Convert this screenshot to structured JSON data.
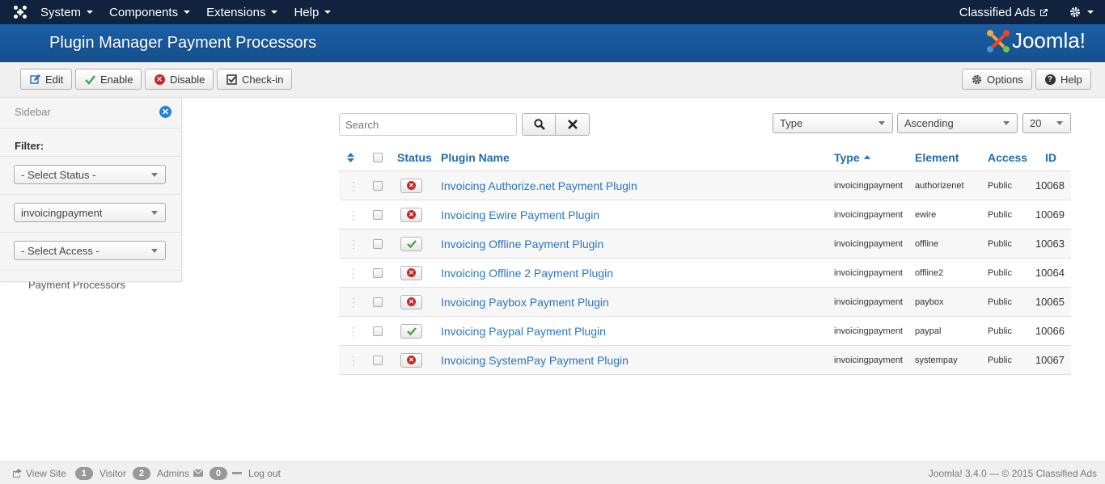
{
  "navbar": {
    "menu": [
      "System",
      "Components",
      "Extensions",
      "Help"
    ],
    "site_link": "Classified Ads"
  },
  "header": {
    "title": "Plugin Manager Payment Processors",
    "brand": "Joomla!"
  },
  "toolbar": {
    "edit": "Edit",
    "enable": "Enable",
    "disable": "Disable",
    "checkin": "Check-in",
    "options": "Options",
    "help": "Help"
  },
  "sidebar": {
    "heading": "Sidebar",
    "filter_label": "Filter:",
    "status_select": "- Select Status -",
    "type_select": "invoicingpayment",
    "access_select": "- Select Access -",
    "hidden_link": "Payment Processors"
  },
  "search": {
    "placeholder": "Search"
  },
  "list_controls": {
    "ordering": "Type",
    "direction": "Ascending",
    "limit": "20"
  },
  "table": {
    "headers": {
      "status": "Status",
      "name": "Plugin Name",
      "type": "Type",
      "element": "Element",
      "access": "Access",
      "id": "ID"
    },
    "rows": [
      {
        "name": "Invoicing Authorize.net Payment Plugin",
        "type": "invoicingpayment",
        "element": "authorizenet",
        "access": "Public",
        "id": "10068",
        "enabled": false
      },
      {
        "name": "Invoicing Ewire Payment Plugin",
        "type": "invoicingpayment",
        "element": "ewire",
        "access": "Public",
        "id": "10069",
        "enabled": false
      },
      {
        "name": "Invoicing Offline Payment Plugin",
        "type": "invoicingpayment",
        "element": "offline",
        "access": "Public",
        "id": "10063",
        "enabled": true
      },
      {
        "name": "Invoicing Offline 2 Payment Plugin",
        "type": "invoicingpayment",
        "element": "offline2",
        "access": "Public",
        "id": "10064",
        "enabled": false
      },
      {
        "name": "Invoicing Paybox Payment Plugin",
        "type": "invoicingpayment",
        "element": "paybox",
        "access": "Public",
        "id": "10065",
        "enabled": false
      },
      {
        "name": "Invoicing Paypal Payment Plugin",
        "type": "invoicingpayment",
        "element": "paypal",
        "access": "Public",
        "id": "10066",
        "enabled": true
      },
      {
        "name": "Invoicing SystemPay Payment Plugin",
        "type": "invoicingpayment",
        "element": "systempay",
        "access": "Public",
        "id": "10067",
        "enabled": false
      }
    ]
  },
  "footer": {
    "view_site": "View Site",
    "visitor_count": "1",
    "visitor_label": "Visitor",
    "admin_count": "2",
    "admin_label": "Admins",
    "message_count": "0",
    "logout": "Log out",
    "copyright": "Joomla! 3.4.0 — © 2015 Classified Ads"
  },
  "colors": {
    "navbar": "#10223e",
    "header": "#1a5fa6",
    "link": "#2a75bf",
    "disabled": "#c52827",
    "enabled": "#46a546"
  }
}
